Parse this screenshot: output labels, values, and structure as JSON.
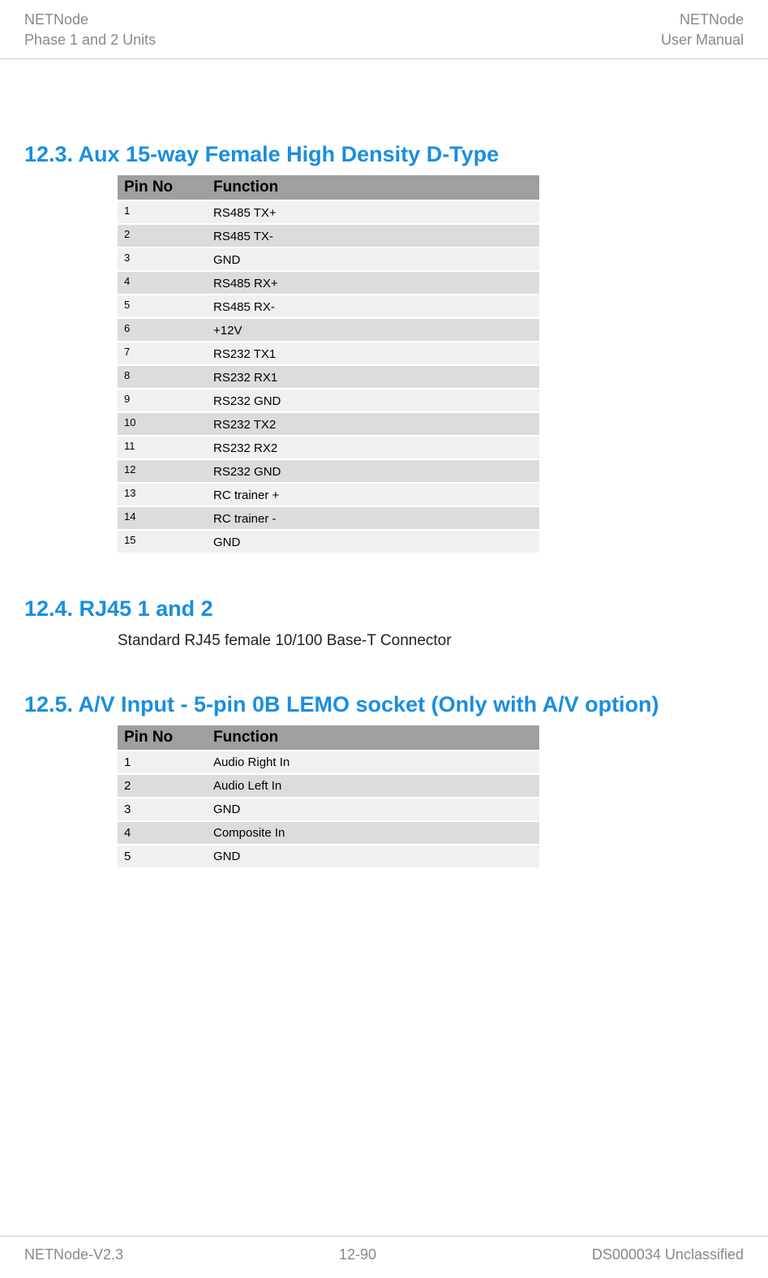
{
  "header": {
    "left_line1": "NETNode",
    "left_line2": "Phase 1 and 2 Units",
    "right_line1": "NETNode",
    "right_line2": "User Manual"
  },
  "section_12_3": {
    "heading": "12.3. Aux 15-way Female High Density D-Type",
    "table": {
      "col_pin": "Pin No",
      "col_func": "Function",
      "rows": [
        {
          "pin": "1",
          "func": "RS485 TX+"
        },
        {
          "pin": "2",
          "func": "RS485 TX-"
        },
        {
          "pin": "3",
          "func": "GND"
        },
        {
          "pin": "4",
          "func": "RS485 RX+"
        },
        {
          "pin": "5",
          "func": "RS485 RX-"
        },
        {
          "pin": "6",
          "func": "+12V"
        },
        {
          "pin": "7",
          "func": "RS232 TX1"
        },
        {
          "pin": "8",
          "func": "RS232 RX1"
        },
        {
          "pin": "9",
          "func": "RS232 GND"
        },
        {
          "pin": "10",
          "func": "RS232 TX2"
        },
        {
          "pin": "11",
          "func": "RS232 RX2"
        },
        {
          "pin": "12",
          "func": "RS232 GND"
        },
        {
          "pin": "13",
          "func": "RC trainer +"
        },
        {
          "pin": "14",
          "func": "RC trainer -"
        },
        {
          "pin": "15",
          "func": "GND"
        }
      ]
    }
  },
  "section_12_4": {
    "heading": "12.4. RJ45 1 and 2",
    "body": "Standard RJ45 female 10/100 Base-T Connector"
  },
  "section_12_5": {
    "heading": "12.5. A/V Input - 5-pin 0B LEMO socket (Only with A/V option)",
    "table": {
      "col_pin": "Pin No",
      "col_func": "Function",
      "rows": [
        {
          "pin": "1",
          "func": "Audio Right In"
        },
        {
          "pin": "2",
          "func": "Audio Left In"
        },
        {
          "pin": "3",
          "func": "GND"
        },
        {
          "pin": "4",
          "func": "Composite In"
        },
        {
          "pin": "5",
          "func": "GND"
        }
      ]
    }
  },
  "footer": {
    "left": "NETNode-V2.3",
    "center": "12-90",
    "right": "DS000034 Unclassified"
  }
}
